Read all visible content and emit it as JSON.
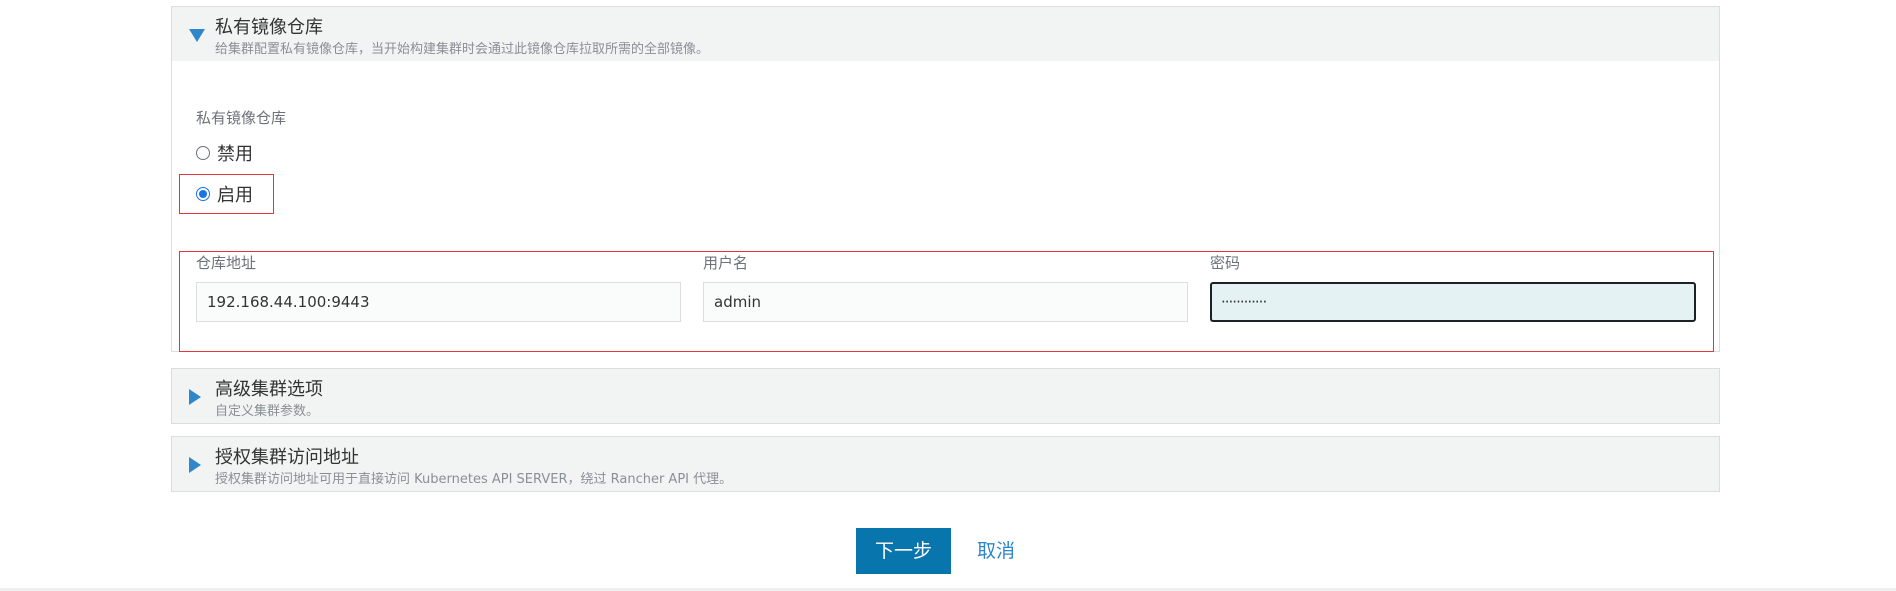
{
  "private_registry": {
    "title": "私有镜像仓库",
    "subtitle": "给集群配置私有镜像仓库，当开始构建集群时会通过此镜像仓库拉取所需的全部镜像。",
    "field_label": "私有镜像仓库",
    "options": [
      {
        "label": "禁用",
        "selected": false
      },
      {
        "label": "启用",
        "selected": true
      }
    ],
    "url_label": "仓库地址",
    "url_value": "192.168.44.100:9443",
    "username_label": "用户名",
    "username_value": "admin",
    "password_label": "密码",
    "password_value": "············"
  },
  "advanced": {
    "title": "高级集群选项",
    "subtitle": "自定义集群参数。"
  },
  "authorized_endpoint": {
    "title": "授权集群访问地址",
    "subtitle": "授权集群访问地址可用于直接访问 Kubernetes API SERVER，绕过 Rancher API 代理。"
  },
  "actions": {
    "next_label": "下一步",
    "cancel_label": "取消"
  },
  "colors": {
    "accent": "#2f86c9",
    "primary_button": "#0975ad",
    "highlight_border": "#e8333b"
  }
}
